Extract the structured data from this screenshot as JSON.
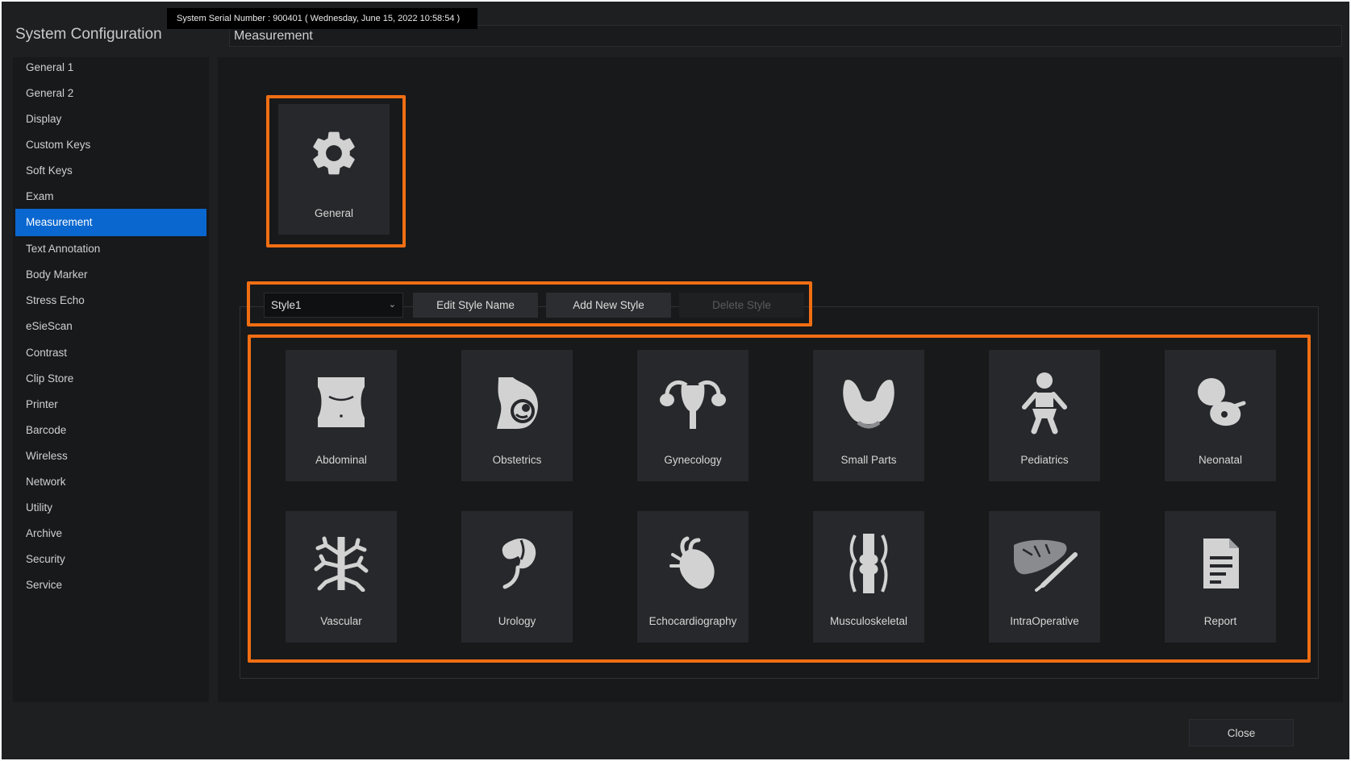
{
  "serial_bar": "System Serial Number : 900401 ( Wednesday, June 15, 2022 10:58:54 )",
  "app_title": "System Configuration",
  "section_title": "Measurement",
  "sidebar": {
    "active": "Measurement",
    "items": [
      {
        "label": "General 1"
      },
      {
        "label": "General 2"
      },
      {
        "label": "Display"
      },
      {
        "label": "Custom Keys"
      },
      {
        "label": "Soft Keys"
      },
      {
        "label": "Exam"
      },
      {
        "label": "Measurement"
      },
      {
        "label": "Text Annotation"
      },
      {
        "label": "Body Marker"
      },
      {
        "label": "Stress Echo"
      },
      {
        "label": "eSieScan"
      },
      {
        "label": "Contrast"
      },
      {
        "label": "Clip Store"
      },
      {
        "label": "Printer"
      },
      {
        "label": "Barcode"
      },
      {
        "label": "Wireless"
      },
      {
        "label": "Network"
      },
      {
        "label": "Utility"
      },
      {
        "label": "Archive"
      },
      {
        "label": "Security"
      },
      {
        "label": "Service"
      }
    ]
  },
  "general_tile": {
    "label": "General",
    "icon": "gear-icon"
  },
  "style_bar": {
    "selected_style": "Style1",
    "edit_label": "Edit Style Name",
    "add_label": "Add New Style",
    "delete_label": "Delete Style"
  },
  "apps": [
    {
      "label": "Abdominal",
      "icon": "abdomen-icon"
    },
    {
      "label": "Obstetrics",
      "icon": "pregnancy-icon"
    },
    {
      "label": "Gynecology",
      "icon": "uterus-icon"
    },
    {
      "label": "Small Parts",
      "icon": "thyroid-icon"
    },
    {
      "label": "Pediatrics",
      "icon": "baby-icon"
    },
    {
      "label": "Neonatal",
      "icon": "fetus-icon"
    },
    {
      "label": "Vascular",
      "icon": "vessel-icon"
    },
    {
      "label": "Urology",
      "icon": "kidney-icon"
    },
    {
      "label": "Echocardiography",
      "icon": "heart-icon"
    },
    {
      "label": "Musculoskeletal",
      "icon": "knee-icon"
    },
    {
      "label": "IntraOperative",
      "icon": "liver-scalpel-icon"
    },
    {
      "label": "Report",
      "icon": "document-icon"
    }
  ],
  "close_label": "Close",
  "colors": {
    "highlight": "#f06e13",
    "active": "#0a67d0",
    "icon": "#d2d2d2"
  }
}
